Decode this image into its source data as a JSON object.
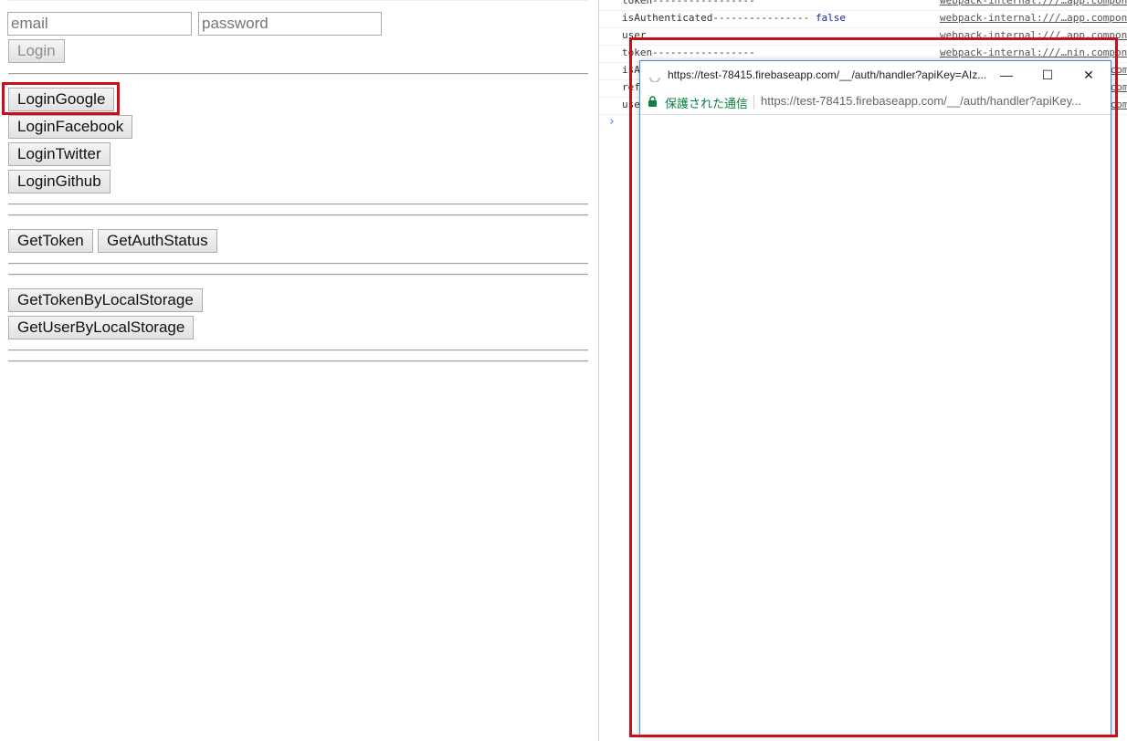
{
  "login_form": {
    "email_placeholder": "email",
    "password_placeholder": "password",
    "login_button": "Login"
  },
  "social_buttons": [
    "LoginGoogle",
    "LoginFacebook",
    "LoginTwitter",
    "LoginGithub"
  ],
  "token_buttons": [
    "GetToken",
    "GetAuthStatus"
  ],
  "storage_buttons": [
    "GetTokenByLocalStorage",
    "GetUserByLocalStorage"
  ],
  "console": {
    "rows": [
      {
        "text": "token-----------------",
        "value": "",
        "source": "webpack-internal:///…app.compone"
      },
      {
        "text": "isAuthenticated----------------",
        "value": "false",
        "source": "webpack-internal:///…app.compone"
      },
      {
        "text": "user",
        "value": "",
        "source": "webpack-internal:///…app.compone"
      },
      {
        "text": "token-----------------",
        "value": "",
        "source": "webpack-internal:///…nin.compone"
      },
      {
        "text": "isA",
        "value": "",
        "source": "…compone"
      },
      {
        "text": "ref",
        "value": "",
        "source": "…compone"
      },
      {
        "text": "use",
        "value": "",
        "source": "…compone"
      }
    ],
    "prompt": "›"
  },
  "popup": {
    "title": "https://test-78415.firebaseapp.com/__/auth/handler?apiKey=AIz...",
    "secure_label": "保護された通信",
    "url": "https://test-78415.firebaseapp.com/__/auth/handler?apiKey...",
    "minimize": "—",
    "maximize": "☐",
    "close": "✕"
  },
  "colors": {
    "highlight": "#c8101a",
    "secure": "#0b8043"
  }
}
